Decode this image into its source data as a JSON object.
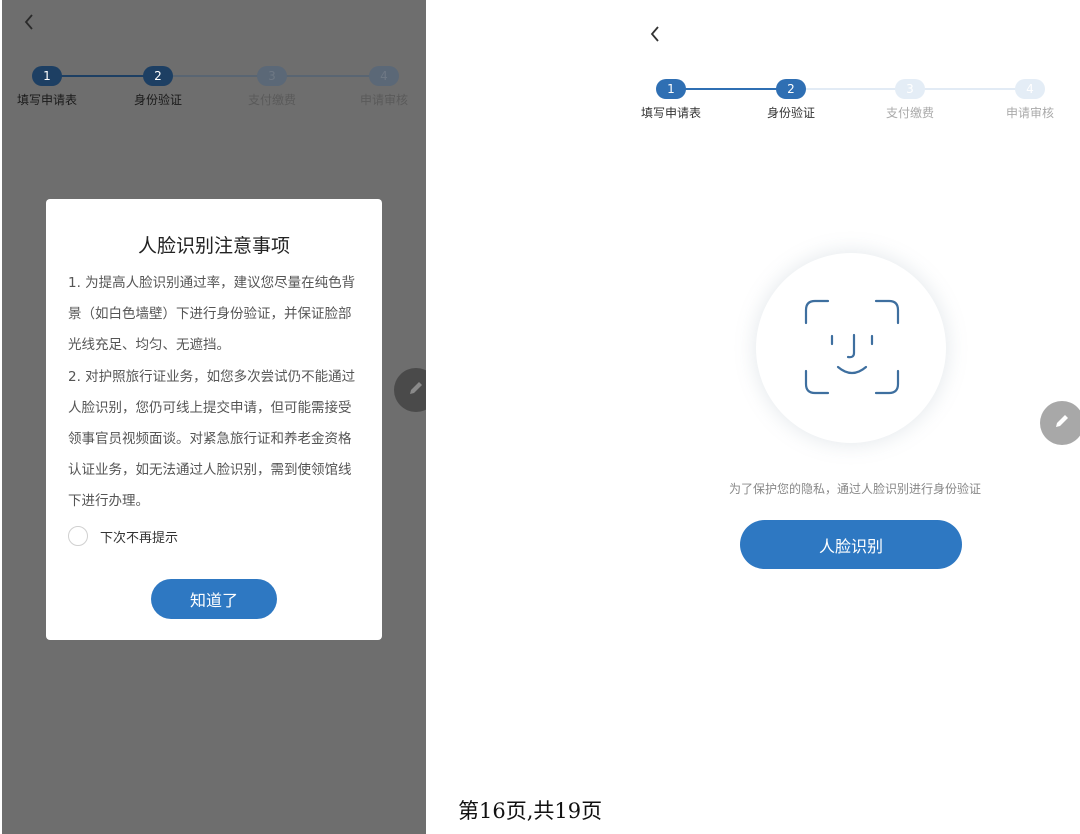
{
  "left_screen": {
    "stepper": {
      "steps": [
        {
          "number": "1",
          "label": "填写申请表"
        },
        {
          "number": "2",
          "label": "身份验证"
        },
        {
          "number": "3",
          "label": "支付缴费"
        },
        {
          "number": "4",
          "label": "申请审核"
        }
      ],
      "current_step": 2
    },
    "modal": {
      "title": "人脸识别注意事项",
      "paragraph_1": "1. 为提高人脸识别通过率，建议您尽量在纯色背景（如白色墙壁）下进行身份验证，并保证脸部光线充足、均匀、无遮挡。",
      "paragraph_2": "2. 对护照旅行证业务，如您多次尝试仍不能通过人脸识别，您仍可线上提交申请，但可能需接受领事官员视频面谈。对紧急旅行证和养老金资格认证业务，如无法通过人脸识别，需到使领馆线下进行办理。",
      "dont_remind_label": "下次不再提示",
      "dont_remind_checked": false,
      "ok_button_label": "知道了"
    }
  },
  "right_screen": {
    "stepper": {
      "steps": [
        {
          "number": "1",
          "label": "填写申请表"
        },
        {
          "number": "2",
          "label": "身份验证"
        },
        {
          "number": "3",
          "label": "支付缴费"
        },
        {
          "number": "4",
          "label": "申请审核"
        }
      ],
      "current_step": 2
    },
    "privacy_text": "为了保护您的隐私，通过人脸识别进行身份验证",
    "face_button_label": "人脸识别"
  },
  "footer": {
    "page_text": "第16页,共19页"
  },
  "colors": {
    "primary_blue": "#2e78c2",
    "dim_overlay": "#6e6e6e"
  },
  "icons": [
    "chevron-left-icon",
    "pencil-icon",
    "face-scan-icon"
  ]
}
